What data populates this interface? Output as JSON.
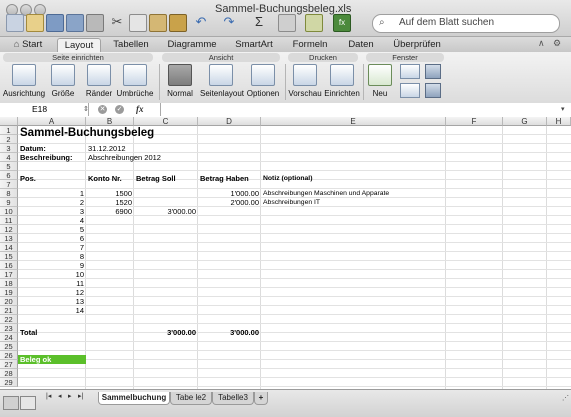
{
  "window": {
    "title": "Sammel-Buchungsbeleg.xls"
  },
  "search": {
    "placeholder": "Auf dem Blatt suchen"
  },
  "ribbon": {
    "tabs": [
      {
        "label": "Start"
      },
      {
        "label": "Layout"
      },
      {
        "label": "Tabellen"
      },
      {
        "label": "Diagramme"
      },
      {
        "label": "SmartArt"
      },
      {
        "label": "Formeln"
      },
      {
        "label": "Daten"
      },
      {
        "label": "Überprüfen"
      }
    ],
    "groups": {
      "seite": "Seite einrichten",
      "ansicht": "Ansicht",
      "drucken": "Drucken",
      "fenster": "Fenster"
    },
    "buttons": {
      "ausrichtung": "Ausrichtung",
      "groesse": "Größe",
      "raender": "Ränder",
      "umbrueche": "Umbrüche",
      "normal": "Normal",
      "seitenlayout": "Seitenlayout",
      "optionen": "Optionen",
      "vorschau": "Vorschau",
      "einrichten": "Einrichten",
      "neu": "Neu"
    }
  },
  "formula": {
    "cell_ref": "E18",
    "fx": "fx",
    "value": ""
  },
  "sheet": {
    "columns": [
      "A",
      "B",
      "C",
      "D",
      "E",
      "F",
      "G",
      "H"
    ],
    "rows": [
      "1",
      "2",
      "3",
      "4",
      "5",
      "6",
      "7",
      "8",
      "9",
      "10",
      "11",
      "12",
      "13",
      "14",
      "15",
      "16",
      "17",
      "18",
      "19",
      "20",
      "21",
      "22",
      "23",
      "24",
      "25",
      "26",
      "27",
      "28",
      "29"
    ],
    "title": "Sammel-Buchungsbeleg",
    "datum_label": "Datum:",
    "datum_value": "31.12.2012",
    "beschreibung_label": "Beschreibung:",
    "beschreibung_value": "Abschreibungen 2012",
    "headers": {
      "pos": "Pos.",
      "konto": "Konto Nr.",
      "soll": "Betrag Soll",
      "haben": "Betrag Haben",
      "notiz": "Notiz (optional)"
    },
    "entries": [
      {
        "pos": "1",
        "konto": "1500",
        "soll": "",
        "haben": "1'000.00",
        "notiz": "Abschreibungen Maschinen und Apparate"
      },
      {
        "pos": "2",
        "konto": "1520",
        "soll": "",
        "haben": "2'000.00",
        "notiz": "Abschreibungen IT"
      },
      {
        "pos": "3",
        "konto": "6900",
        "soll": "3'000.00",
        "haben": "",
        "notiz": ""
      },
      {
        "pos": "4"
      },
      {
        "pos": "5"
      },
      {
        "pos": "6"
      },
      {
        "pos": "7"
      },
      {
        "pos": "8"
      },
      {
        "pos": "9"
      },
      {
        "pos": "10"
      },
      {
        "pos": "11"
      },
      {
        "pos": "12"
      },
      {
        "pos": "13"
      },
      {
        "pos": "14"
      }
    ],
    "total_label": "Total",
    "total_soll": "3'000.00",
    "total_haben": "3'000.00",
    "status_label": "Beleg ok",
    "status_color": "#5bbf2a"
  },
  "sheet_tabs": [
    {
      "label": "Sammelbuchung",
      "active": true
    },
    {
      "label": "Tabe le2",
      "active": false
    },
    {
      "label": "Tabelle3",
      "active": false
    },
    {
      "label": "+",
      "active": false
    }
  ]
}
